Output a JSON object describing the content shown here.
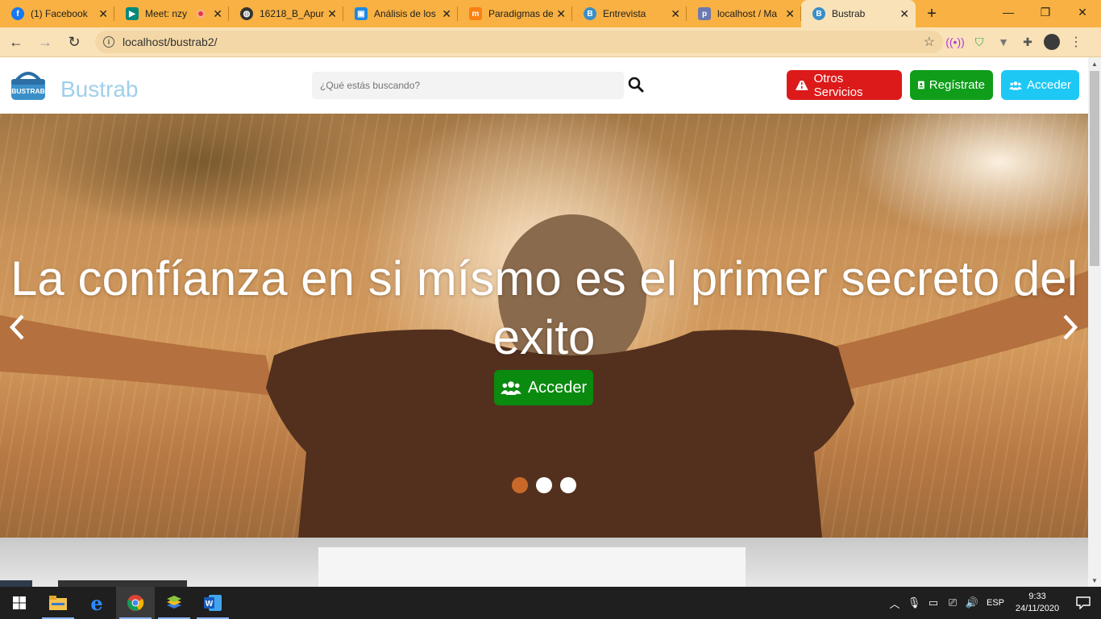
{
  "browser": {
    "tabs": [
      {
        "title": "(1) Facebook",
        "icon": "facebook-icon",
        "color": "#1877f2",
        "active": false
      },
      {
        "title": "Meet: nzy",
        "icon": "meet-icon",
        "color": "#00897b",
        "active": false,
        "recording": true
      },
      {
        "title": "16218_B_Apun",
        "icon": "globe-icon",
        "color": "#333333",
        "active": false
      },
      {
        "title": "Análisis de los",
        "icon": "classroom-icon",
        "color": "#1e88e5",
        "active": false
      },
      {
        "title": "Paradigmas de",
        "icon": "moodle-icon",
        "color": "#f98012",
        "active": false
      },
      {
        "title": "Entrevista",
        "icon": "bustrab-icon",
        "color": "#3a8fc8",
        "active": false
      },
      {
        "title": "localhost / Ma",
        "icon": "phpmyadmin-icon",
        "color": "#6c78af",
        "active": false
      },
      {
        "title": "Bustrab",
        "icon": "bustrab-icon",
        "color": "#3a8fc8",
        "active": true
      }
    ],
    "url": "localhost/bustrab2/"
  },
  "site": {
    "brand": "Bustrab",
    "logo_text": "BUSTRAB",
    "search_placeholder": "¿Qué estás buscando?",
    "buttons": {
      "services": "Otros Servicios",
      "register": "Regístrate",
      "login": "Acceder"
    },
    "colors": {
      "services": "#dc1a1a",
      "register": "#0f9d1a",
      "login": "#1ec8f4",
      "hero_button": "#0a8a0f",
      "dot_active": "#c8692a"
    }
  },
  "hero": {
    "headline": "La confíanza en si mísmo es el primer secreto del exito",
    "button": "Acceder",
    "slides": 3,
    "active_slide": 1
  },
  "taskbar": {
    "apps": [
      "start-icon",
      "file-explorer-icon",
      "edge-icon",
      "chrome-icon",
      "bluestacks-icon",
      "word-icon"
    ],
    "language": "ESP",
    "time": "9:33",
    "date": "24/11/2020"
  }
}
